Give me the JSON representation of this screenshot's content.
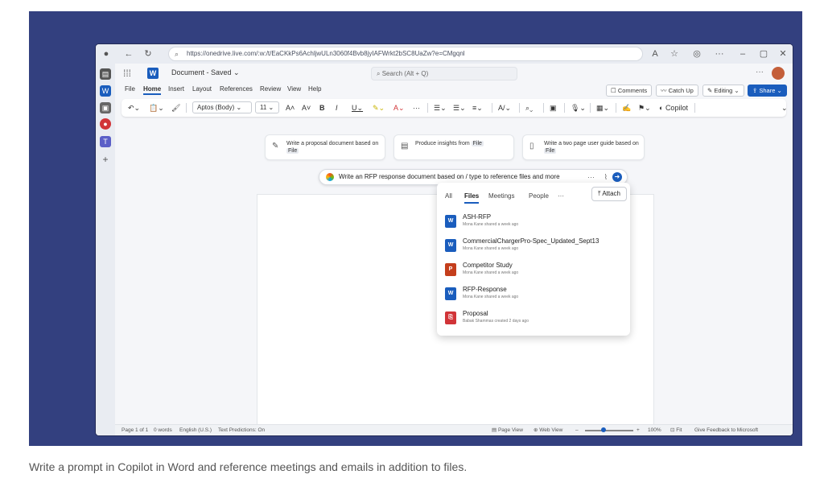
{
  "browser": {
    "url": "https://onedrive.live.com/:w:/t/EaCKkPs6AchljwULn3060f4Bvb8jyIAFWrkt2bSC8UaZw?e=CMgqnl",
    "back_icon": "back-arrow-icon",
    "refresh_icon": "refresh-icon",
    "more": "···",
    "minimize": "–",
    "maximize": "▢",
    "close": "✕"
  },
  "app": {
    "doc_title": "Document - Saved ⌄",
    "search_placeholder": "Search (Alt + Q)",
    "menu": [
      "File",
      "Home",
      "Insert",
      "Layout",
      "References",
      "Review",
      "View",
      "Help"
    ],
    "active_menu": "Home",
    "comments": "Comments",
    "catch_up": "Catch Up",
    "editing": "Editing ⌄",
    "share": "Share ⌄",
    "font_name": "Aptos (Body)",
    "font_size": "11",
    "copilot": "Copilot"
  },
  "suggestions": [
    {
      "text": "Write a proposal document based on",
      "tag": "File"
    },
    {
      "text": "Produce insights from",
      "tag": "File"
    },
    {
      "text": "Write a two page user guide based on",
      "tag": "File"
    }
  ],
  "prompt": {
    "text": "Write an RFP response document based on / type to reference files and more",
    "more": "···"
  },
  "dropdown": {
    "tabs": [
      "All",
      "Files",
      "Meetings",
      "People",
      "···"
    ],
    "active_tab": "Files",
    "attach": "Attach",
    "files": [
      {
        "name": "ASH-RFP",
        "meta": "Mona Kane shared a week ago",
        "type": "word",
        "color": "#1a5dbd"
      },
      {
        "name": "CommercialChargerPro-Spec_Updated_Sept13",
        "meta": "Mona Kane shared a week ago",
        "type": "word",
        "color": "#1a5dbd"
      },
      {
        "name": "Competitor Study",
        "meta": "Mona Kane shared a week ago",
        "type": "ppt",
        "color": "#c43e1c"
      },
      {
        "name": "RFP-Response",
        "meta": "Mona Kane shared a week ago",
        "type": "word",
        "color": "#1a5dbd"
      },
      {
        "name": "Proposal",
        "meta": "Babak Shammas created 2 days ago",
        "type": "pdf",
        "color": "#d13438"
      }
    ]
  },
  "status": {
    "page": "Page 1 of 1",
    "words": "0 words",
    "lang": "English (U.S.)",
    "predictions": "Text Predictions: On",
    "page_view": "Page View",
    "web_view": "Web View",
    "zoom": "100%",
    "fit": "Fit",
    "feedback": "Give Feedback to Microsoft"
  },
  "caption": "Write a prompt in Copilot in Word and reference meetings and emails in addition to files."
}
